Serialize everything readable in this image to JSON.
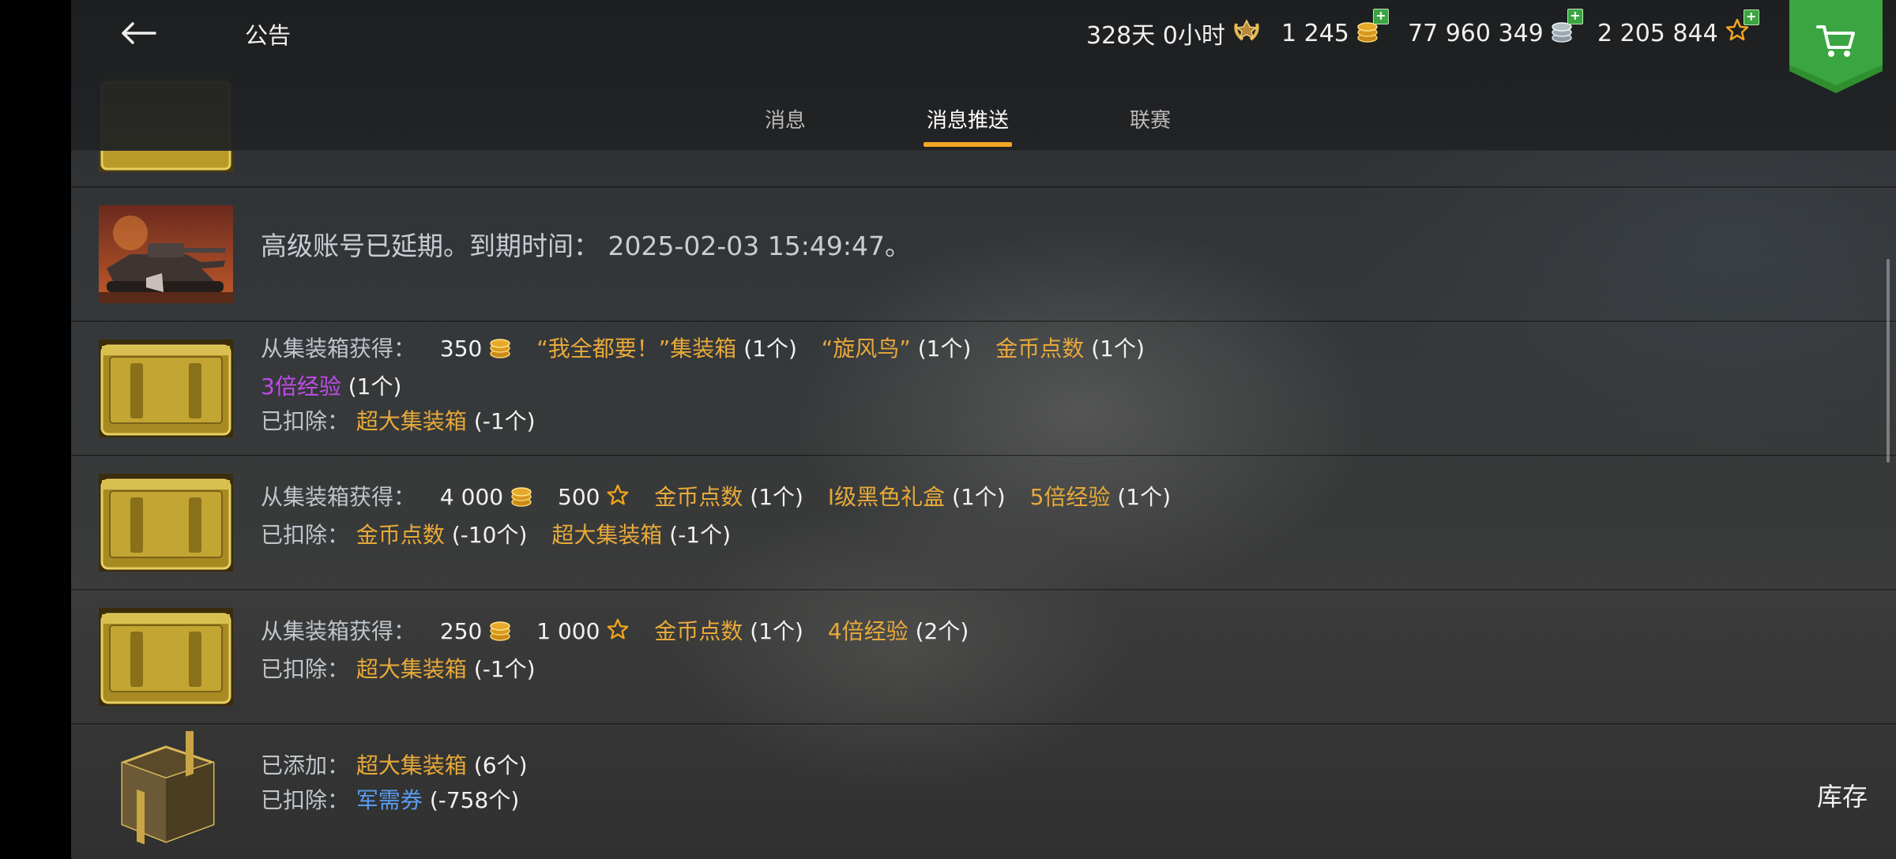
{
  "header": {
    "title": "公告",
    "premium_time": "328天 0小时",
    "gold": "1 245",
    "credits": "77 960 349",
    "free_xp": "2 205 844"
  },
  "tabs": [
    {
      "label": "消息",
      "active": false
    },
    {
      "label": "消息推送",
      "active": true
    },
    {
      "label": "联赛",
      "active": false
    }
  ],
  "messages": {
    "premium": {
      "label": "高级账号已延期。到期时间：",
      "date": "2025-02-03 15:49:47。"
    },
    "m1": {
      "obtained_label": "从集装箱获得：",
      "gold": "350",
      "item1": "“我全都要！”集装箱",
      "item1_count": "(1个)",
      "item2": "“旋风鸟”",
      "item2_count": "(1个)",
      "item3": "金币点数",
      "item3_count": "(1个)",
      "item4": "3倍经验",
      "item4_count": "(1个)",
      "deducted_label": "已扣除：",
      "deducted_item": "超大集装箱",
      "deducted_count": "(-1个)"
    },
    "m2": {
      "obtained_label": "从集装箱获得：",
      "gold": "4 000",
      "free_xp": "500",
      "item1": "金币点数",
      "item1_count": "(1个)",
      "item2": "I级黑色礼盒",
      "item2_count": "(1个)",
      "item3": "5倍经验",
      "item3_count": "(1个)",
      "deducted_label": "已扣除：",
      "deducted_item1": "金币点数",
      "deducted_count1": "(-10个)",
      "deducted_item2": "超大集装箱",
      "deducted_count2": "(-1个)"
    },
    "m3": {
      "obtained_label": "从集装箱获得：",
      "gold": "250",
      "free_xp": "1 000",
      "item1": "金币点数",
      "item1_count": "(1个)",
      "item2": "4倍经验",
      "item2_count": "(2个)",
      "deducted_label": "已扣除：",
      "deducted_item": "超大集装箱",
      "deducted_count": "(-1个)"
    },
    "m4": {
      "added_label": "已添加：",
      "added_item": "超大集装箱",
      "added_count": "(6个)",
      "deducted_label": "已扣除：",
      "deducted_item": "军需券",
      "deducted_count": "(-758个)"
    }
  },
  "inventory_label": "库存",
  "colors": {
    "accent": "#f5a623",
    "item_gold": "#e8a93a",
    "item_purple": "#c04ce8",
    "item_blue": "#5b9cf0",
    "plus_green": "#3aa541",
    "shop_green": "#2f8f2f"
  },
  "icons": [
    "back-arrow-icon",
    "premium-laurel-icon",
    "gold-coins-icon",
    "silver-credits-icon",
    "free-xp-star-icon",
    "shopping-cart-icon",
    "plus-icon"
  ]
}
